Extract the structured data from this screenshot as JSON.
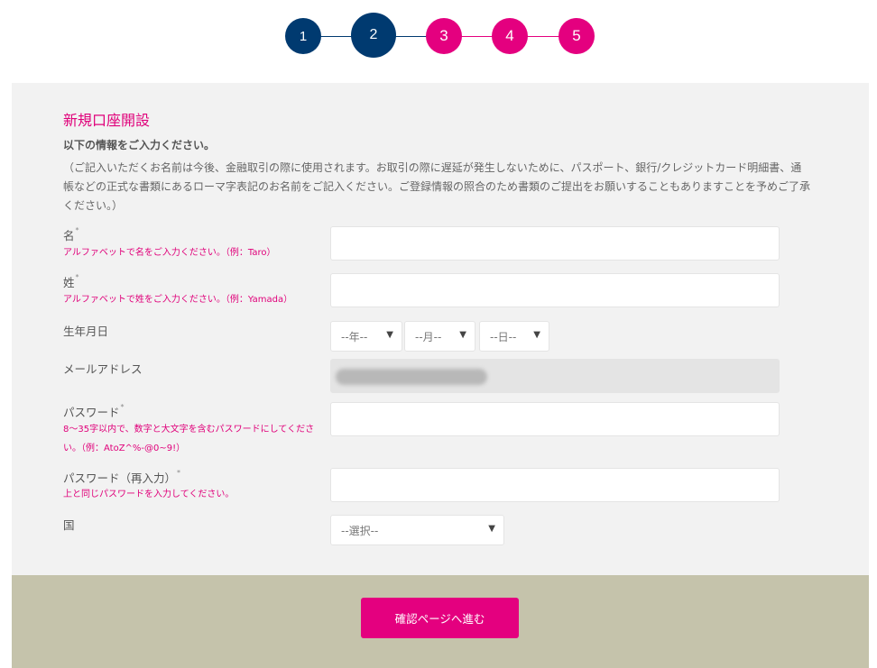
{
  "colors": {
    "step_done": "#003a70",
    "step_todo": "#e4007f",
    "accent": "#e0007a",
    "footer_bg": "#c5c3ab",
    "panel_bg": "#f2f2f2"
  },
  "stepper": {
    "current_step": 2,
    "steps": [
      "1",
      "2",
      "3",
      "4",
      "5"
    ]
  },
  "form": {
    "title": "新規口座開設",
    "subtitle": "以下の情報をご入力ください。",
    "notice": "（ご記入いただくお名前は今後、金融取引の際に使用されます。お取引の際に遅延が発生しないために、パスポート、銀行/クレジットカード明細書、通帳などの正式な書類にあるローマ字表記のお名前をご記入ください。ご登録情報の照合のため書類のご提出をお願いすることもありますことを予めご了承ください。）",
    "first_name": {
      "label": "名",
      "required": "*",
      "hint": "アルファベットで名をご入力ください。（例：Taro）",
      "value": ""
    },
    "last_name": {
      "label": "姓",
      "required": "*",
      "hint": "アルファベットで姓をご入力ください。（例：Yamada）",
      "value": ""
    },
    "birthdate": {
      "label": "生年月日",
      "year": "--年--",
      "month": "--月--",
      "day": "--日--"
    },
    "email": {
      "label": "メールアドレス"
    },
    "password": {
      "label": "パスワード",
      "required": "*",
      "hint": "8～35字以内で、数字と大文字を含むパスワードにしてください。（例：AtoZ^%-@0~9!）",
      "value": ""
    },
    "password_confirm": {
      "label": "パスワード（再入力）",
      "required": "*",
      "hint": "上と同じパスワードを入力してください。",
      "value": ""
    },
    "country": {
      "label": "国",
      "selected": "--選択--"
    }
  },
  "footer": {
    "submit_label": "確認ページへ進む"
  },
  "icons": {
    "dropdown": "▼"
  }
}
